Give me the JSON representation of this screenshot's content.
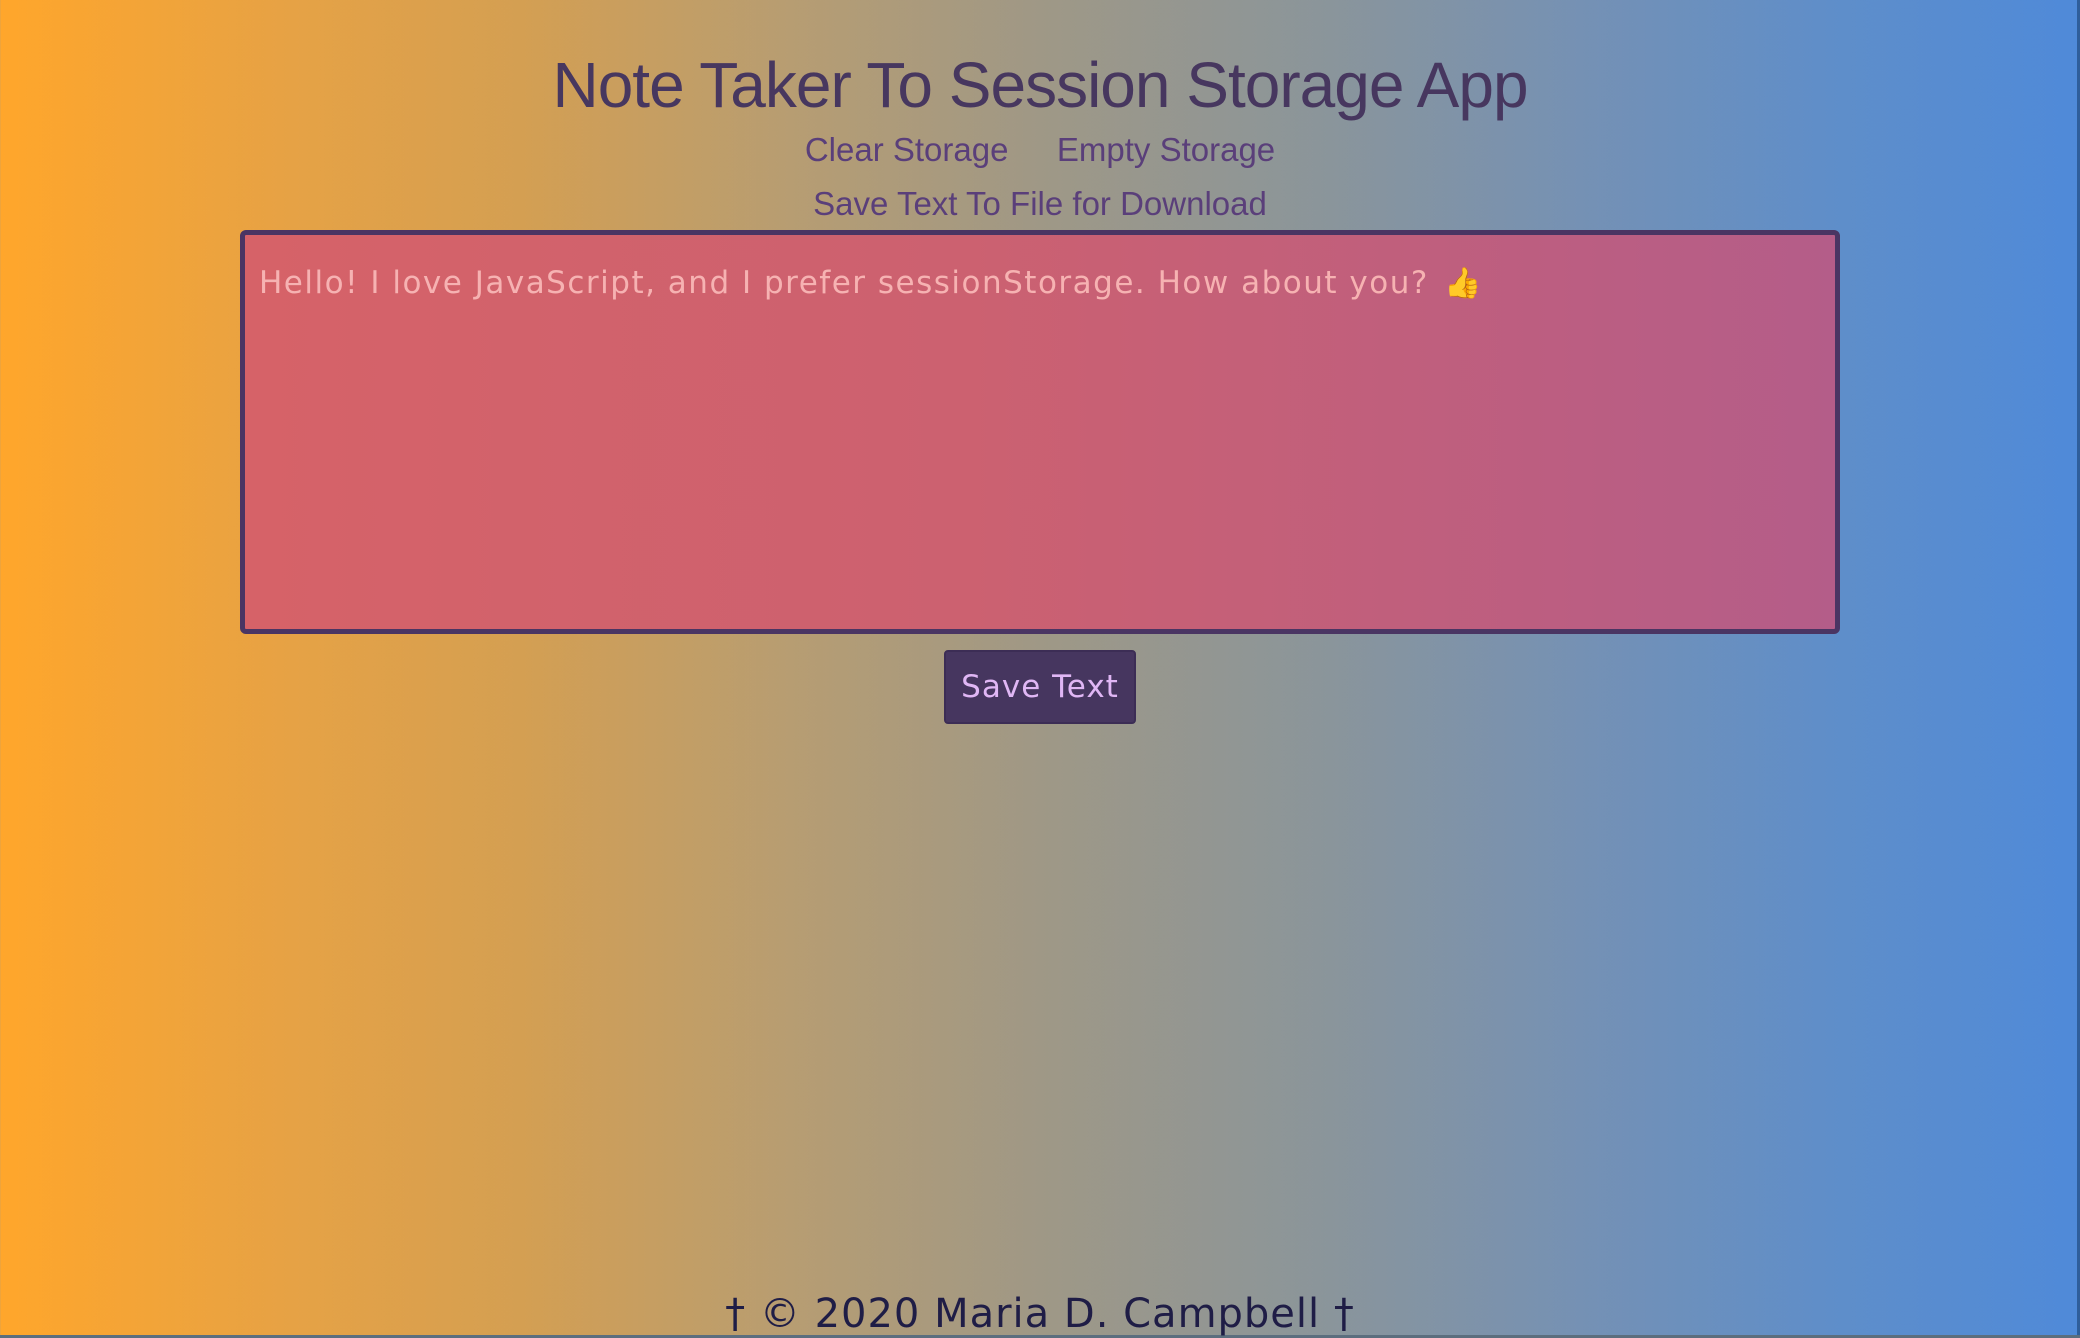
{
  "app": {
    "title": "Note Taker To Session Storage App"
  },
  "nav": {
    "clear_storage": "Clear Storage",
    "empty_storage": "Empty Storage",
    "save_to_file": "Save Text To File for Download"
  },
  "note": {
    "text": "Hello! I love JavaScript, and I prefer sessionStorage. How about you?",
    "emoji": "👍",
    "emoji_name": "thumbs-up-icon"
  },
  "actions": {
    "save_text_label": "Save Text"
  },
  "footer": {
    "copyright": "† © 2020 Maria D. Campbell †"
  },
  "colors": {
    "gradient_start": "#ffa62b",
    "gradient_end": "#4f8ad9",
    "title": "#47375f",
    "link": "#5a3f7a",
    "textarea_border": "#4a3563",
    "textarea_bg_start": "#d66268",
    "textarea_bg_end": "#b45d89",
    "button_bg": "#46365f",
    "button_text": "#e0b7f5",
    "footer_text": "#1f1d46"
  }
}
